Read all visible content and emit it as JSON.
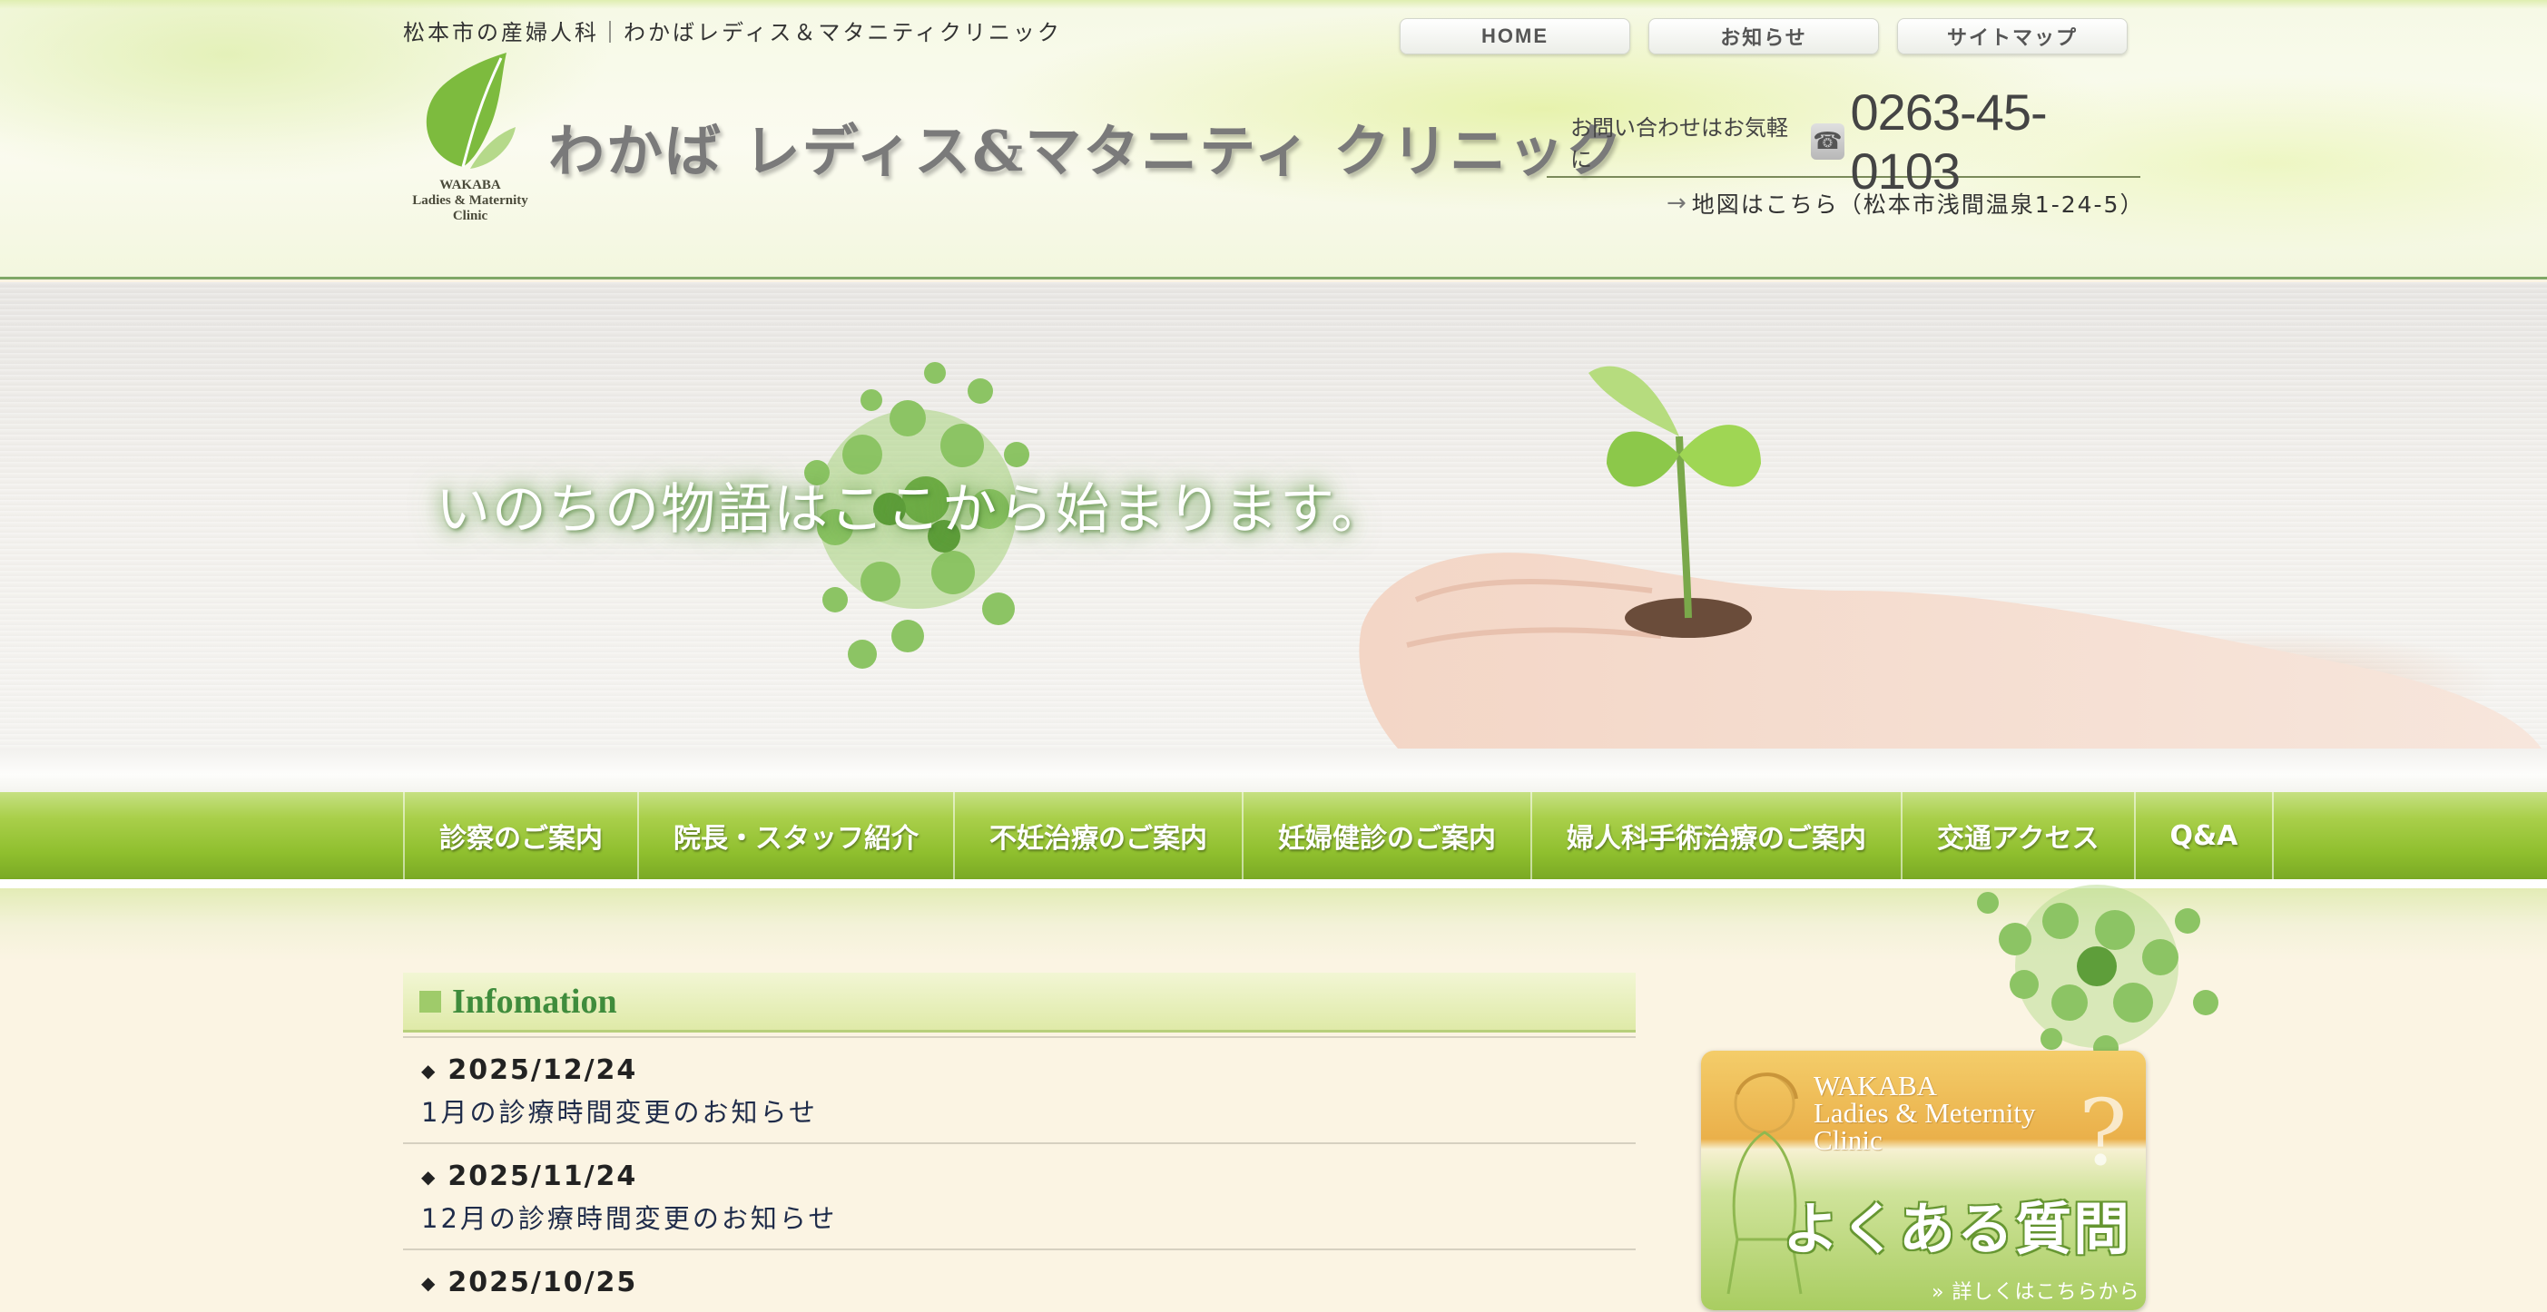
{
  "header": {
    "tagline": "松本市の産婦人科｜わかばレディス＆マタニティクリニック",
    "top_nav": [
      "HOME",
      "お知らせ",
      "サイトマップ"
    ],
    "logo_sub": [
      "WAKABA",
      "Ladies & Maternity",
      "Clinic"
    ],
    "clinic_name": "わかば レディス&マタニティ クリニック",
    "contact_lead": "お問い合わせはお気軽に",
    "phone": "0263-45-0103",
    "map_link": "地図はこちら（松本市浅間温泉1-24-5）"
  },
  "hero": {
    "text": "いのちの物語はここから始まります。"
  },
  "main_nav": [
    "診察のご案内",
    "院長・スタッフ紹介",
    "不妊治療のご案内",
    "妊婦健診のご案内",
    "婦人科手術治療のご案内",
    "交通アクセス",
    "Q&A"
  ],
  "info": {
    "title": "Infomation",
    "items": [
      {
        "date": "2025/12/24",
        "text": "1月の診療時間変更のお知らせ"
      },
      {
        "date": "2025/11/24",
        "text": "12月の診療時間変更のお知らせ"
      },
      {
        "date": "2025/10/25",
        "text": ""
      }
    ]
  },
  "faq_banner": {
    "en": [
      "WAKABA",
      "Ladies & Meternity",
      "Clinic"
    ],
    "q": "?",
    "jp": "よくある質問",
    "more": "» 詳しくはこちらから"
  },
  "icons": {
    "phone": "phone-icon",
    "arrow": "arrow-right-icon",
    "diamond": "diamond-bullet-icon"
  },
  "colors": {
    "nav_green": "#8fbf2e",
    "info_title": "#3f8c3c",
    "page_bg": "#fbf4e3"
  }
}
